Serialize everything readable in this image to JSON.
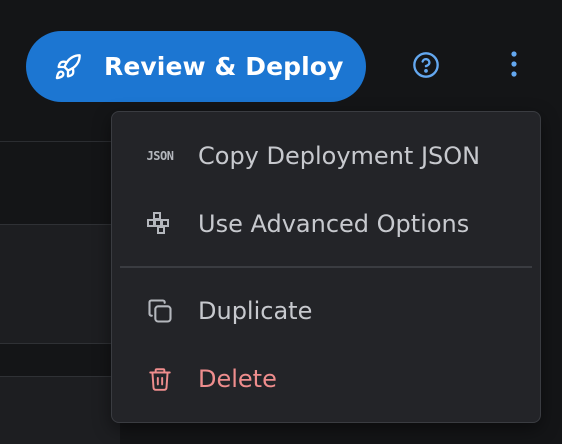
{
  "toolbar": {
    "deploy_label": "Review & Deploy",
    "deploy_icon": "rocket-icon",
    "help_icon": "help-circle-icon",
    "more_icon": "more-vertical-icon"
  },
  "menu": {
    "items": [
      {
        "label": "Copy Deployment JSON",
        "icon": "json-icon",
        "badge": "JSON"
      },
      {
        "label": "Use Advanced Options",
        "icon": "blocks-icon"
      },
      {
        "label": "Duplicate",
        "icon": "duplicate-icon"
      },
      {
        "label": "Delete",
        "icon": "trash-icon",
        "danger": true
      }
    ]
  },
  "colors": {
    "background": "#141517",
    "primary": "#1c76d2",
    "help": "#64a8f0",
    "menu_bg": "#232428",
    "menu_text": "#c7c9ce",
    "danger": "#ef8d8d"
  }
}
